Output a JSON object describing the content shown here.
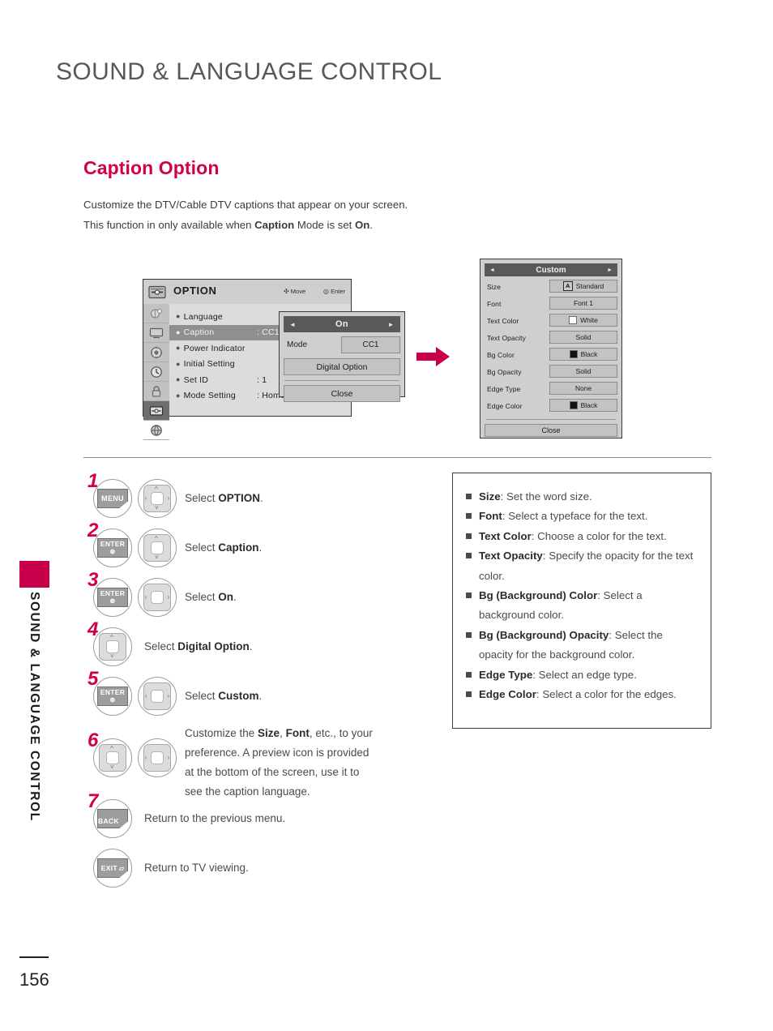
{
  "page_title": "SOUND & LANGUAGE CONTROL",
  "page_number": "156",
  "side_tab_text": "SOUND & LANGUAGE CONTROL",
  "accent_color": "#d2004b",
  "section": {
    "heading": "Caption Option",
    "intro_line1": "Customize the DTV/Cable DTV captions that appear on your screen.",
    "intro_line2_a": "This function in only available when ",
    "intro_line2_b": "Caption",
    "intro_line2_c": " Mode is set ",
    "intro_line2_d": "On",
    "intro_line2_e": "."
  },
  "osd_option": {
    "title": "OPTION",
    "hint_move": "Move",
    "hint_enter": "Enter",
    "icons": [
      "picture-icon",
      "screen-icon",
      "audio-icon",
      "time-icon",
      "lock-icon",
      "option-icon",
      "network-icon"
    ],
    "rows": [
      {
        "label": "Language",
        "value": "",
        "selected": false
      },
      {
        "label": "Caption",
        "value": ": CC1",
        "selected": true
      },
      {
        "label": "Power Indicator",
        "value": "",
        "selected": false
      },
      {
        "label": "Initial Setting",
        "value": "",
        "selected": false
      },
      {
        "label": "Set ID",
        "value": ": 1",
        "selected": false
      },
      {
        "label": "Mode Setting",
        "value": ": Home Use",
        "selected": false
      }
    ]
  },
  "osd_caption_popup": {
    "header": "On",
    "arrow_left": "◄",
    "arrow_right": "►",
    "mode_label": "Mode",
    "mode_value": "CC1",
    "digital_option": "Digital Option",
    "close": "Close"
  },
  "osd_custom": {
    "header": "Custom",
    "arrow_left": "◄",
    "arrow_right": "►",
    "rows": [
      {
        "label": "Size",
        "value": "Standard",
        "swatch": "letter-a"
      },
      {
        "label": "Font",
        "value": "Font 1",
        "swatch": "none"
      },
      {
        "label": "Text Color",
        "value": "White",
        "swatch": "white"
      },
      {
        "label": "Text Opacity",
        "value": "Solid",
        "swatch": "none"
      },
      {
        "label": "Bg Color",
        "value": "Black",
        "swatch": "black"
      },
      {
        "label": "Bg Opacity",
        "value": "Solid",
        "swatch": "none"
      },
      {
        "label": "Edge Type",
        "value": "None",
        "swatch": "none"
      },
      {
        "label": "Edge Color",
        "value": "Black",
        "swatch": "black"
      }
    ],
    "close": "Close"
  },
  "steps": [
    {
      "num": "1",
      "key": "MENU",
      "key_type": "menu",
      "dpad": "4way",
      "text_pre": "Select ",
      "text_bold": "OPTION",
      "text_post": "."
    },
    {
      "num": "2",
      "key": "ENTER",
      "key_sub": "⊛",
      "key_type": "enter",
      "dpad": "updown",
      "text_pre": "Select ",
      "text_bold": "Caption",
      "text_post": "."
    },
    {
      "num": "3",
      "key": "ENTER",
      "key_sub": "⊛",
      "key_type": "enter",
      "dpad": "leftright",
      "text_pre": "Select ",
      "text_bold": "On",
      "text_post": "."
    },
    {
      "num": "4",
      "key": "",
      "key_type": "none",
      "dpad": "updown",
      "text_pre": "Select ",
      "text_bold": "Digital Option",
      "text_post": "."
    },
    {
      "num": "5",
      "key": "ENTER",
      "key_sub": "⊛",
      "key_type": "enter",
      "dpad": "leftright",
      "text_pre": "Select ",
      "text_bold": "Custom",
      "text_post": "."
    }
  ],
  "step6": {
    "num": "6",
    "dpad_a": "updown",
    "dpad_b": "leftright",
    "t1": "Customize the ",
    "b1": "Size",
    "t2": ", ",
    "b2": "Font",
    "t3": ", etc., to your",
    "line2": "preference. A preview icon is provided",
    "line3": "at the bottom of the screen, use it to",
    "line4": "see the caption language."
  },
  "step7": {
    "num": "7",
    "key": "BACK",
    "text": "Return to the previous menu."
  },
  "step_exit": {
    "key": "EXIT",
    "text": "Return to TV viewing."
  },
  "descriptions": [
    {
      "term": "Size",
      "sep": ": ",
      "text": "Set the word size."
    },
    {
      "term": "Font",
      "sep": ": ",
      "text": "Select a typeface for the text."
    },
    {
      "term": "Text Color",
      "sep": ": ",
      "text": "Choose a color for the text."
    },
    {
      "term": "Text Opacity",
      "sep": ": ",
      "text": "Specify the opacity for the text color."
    },
    {
      "term": "Bg (Background) Color",
      "sep": ": ",
      "text": "Select a background color."
    },
    {
      "term": "Bg (Background) Opacity",
      "sep": ": ",
      "text": "Select the opacity for the background color."
    },
    {
      "term": "Edge Type",
      "sep": ": ",
      "text": "Select an edge type."
    },
    {
      "term": "Edge Color",
      "sep": ": ",
      "text": "Select a color for the edges."
    }
  ]
}
